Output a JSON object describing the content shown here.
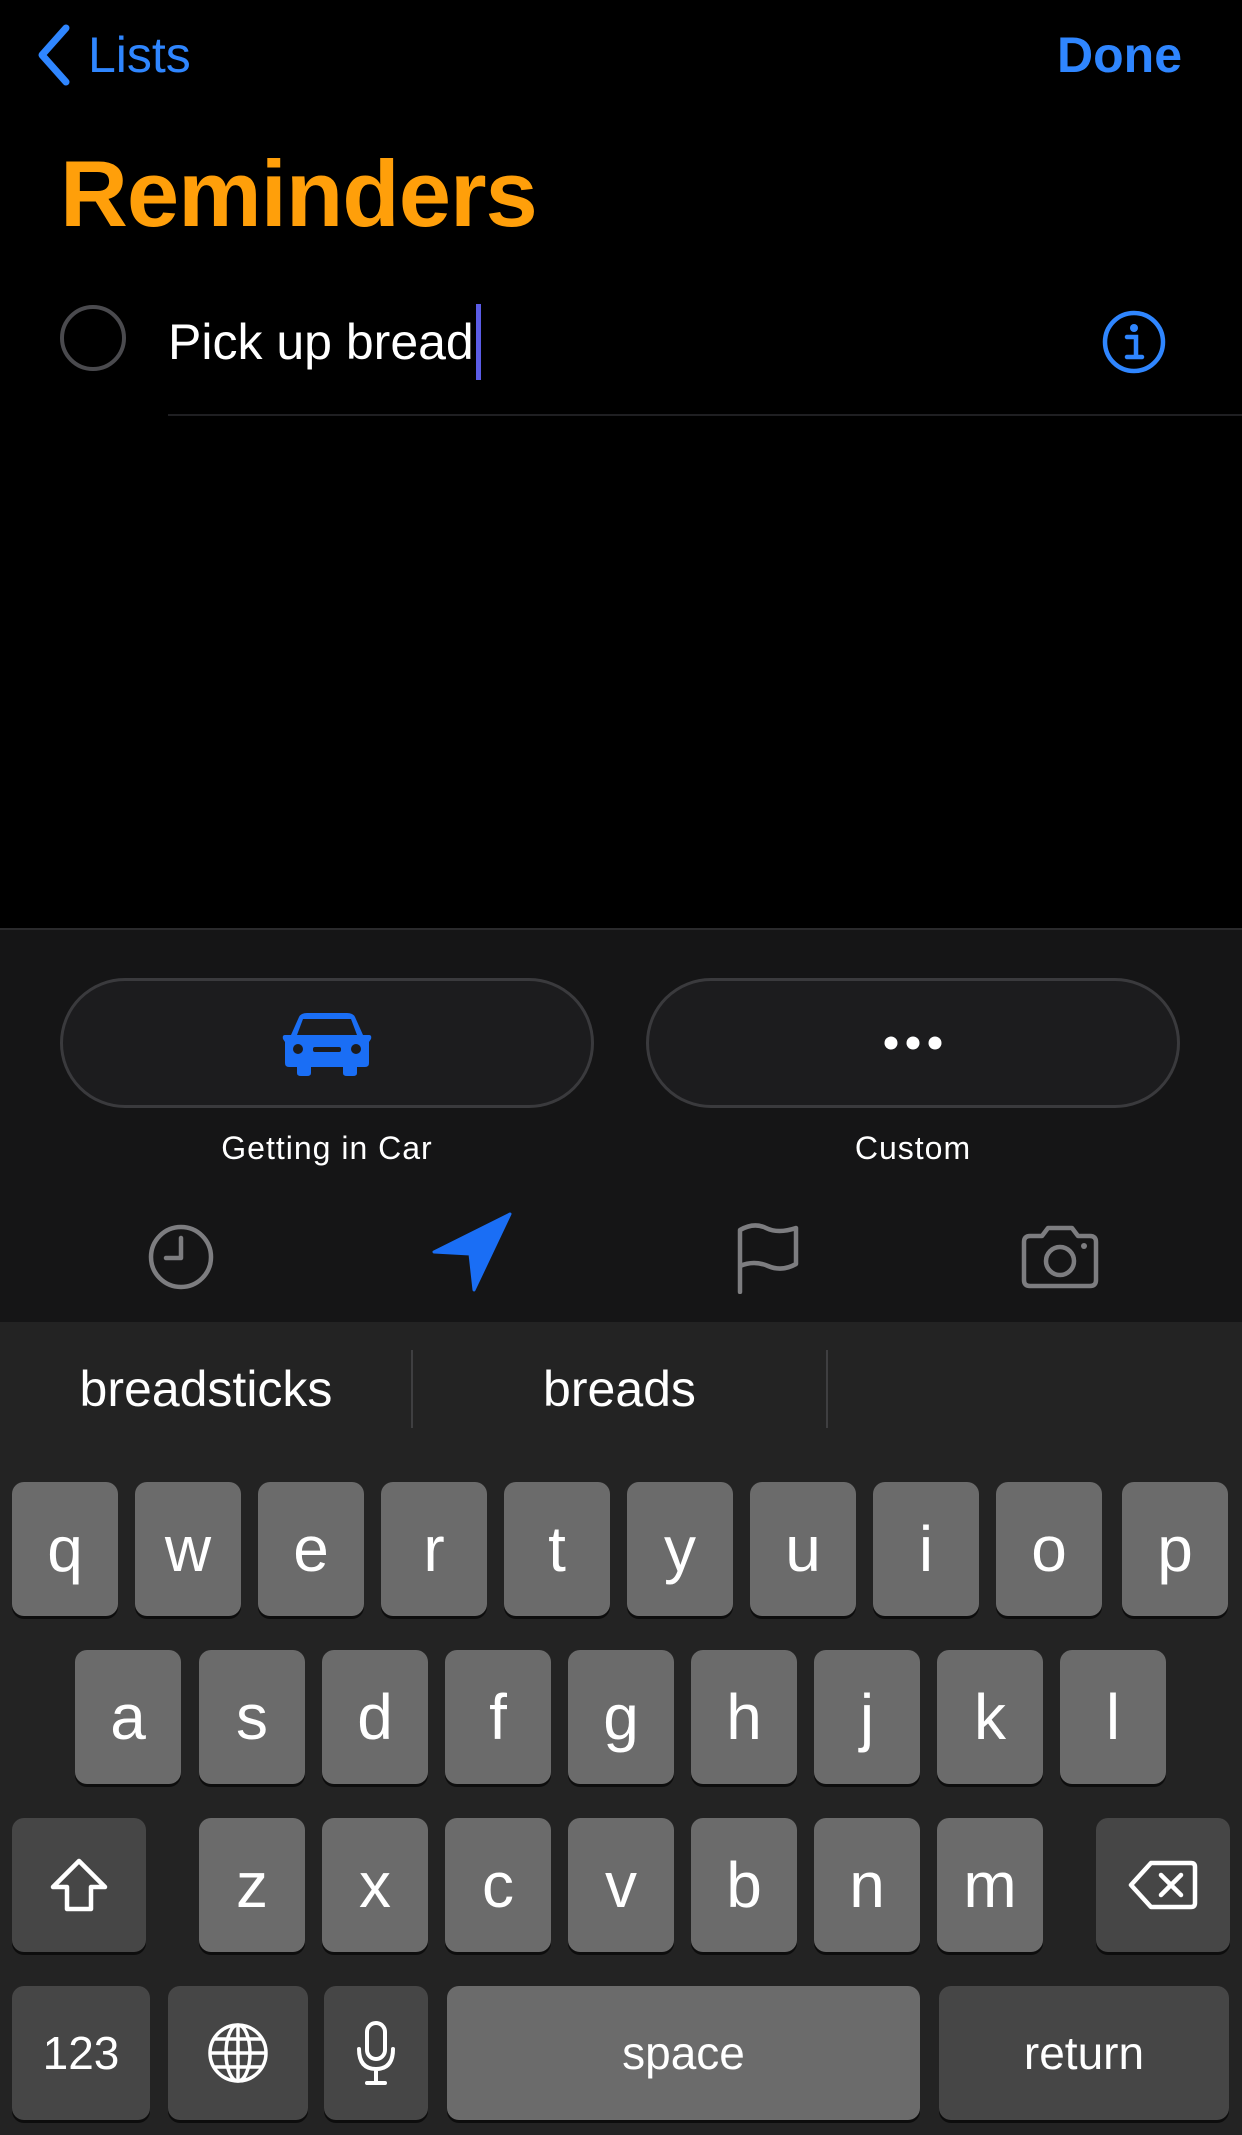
{
  "nav": {
    "back_label": "Lists",
    "done_label": "Done"
  },
  "list_title": "Reminders",
  "reminder": {
    "text": "Pick up bread"
  },
  "location_options": [
    {
      "label": "Getting in Car",
      "icon": "car-icon"
    },
    {
      "label": "Custom",
      "icon": "ellipsis-icon"
    }
  ],
  "toolbar": {
    "items": [
      "clock-icon",
      "location-arrow-icon",
      "flag-icon",
      "camera-icon"
    ],
    "active": "location-arrow-icon"
  },
  "predictions": [
    "breadsticks",
    "breads",
    ""
  ],
  "keyboard": {
    "row1": [
      "q",
      "w",
      "e",
      "r",
      "t",
      "y",
      "u",
      "i",
      "o",
      "p"
    ],
    "row2": [
      "a",
      "s",
      "d",
      "f",
      "g",
      "h",
      "j",
      "k",
      "l"
    ],
    "row3": [
      "z",
      "x",
      "c",
      "v",
      "b",
      "n",
      "m"
    ],
    "numbers_label": "123",
    "space_label": "space",
    "return_label": "return"
  },
  "colors": {
    "accent_blue": "#2f86ff",
    "title_orange": "#ff9f0a",
    "caret": "#5b5ce6"
  }
}
